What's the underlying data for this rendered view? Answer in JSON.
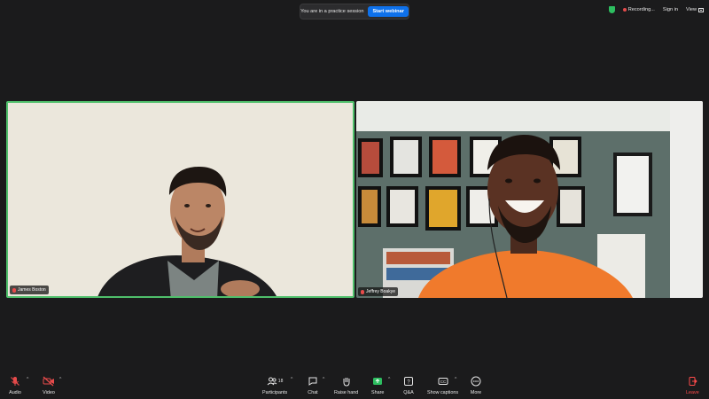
{
  "banner": {
    "text": "You are in a practice session",
    "button": "Start webinar"
  },
  "top_right": {
    "recording": "Recording...",
    "sign_in": "Sign in",
    "view": "View"
  },
  "participants": [
    {
      "name": "James Boston"
    },
    {
      "name": "Jeffrey Boakye"
    }
  ],
  "toolbar": {
    "audio": "Audio",
    "video": "Video",
    "participants": "Participants",
    "participants_count": "18",
    "chat": "Chat",
    "raise_hand": "Raise hand",
    "share": "Share",
    "qa": "Q&A",
    "show_captions": "Show captions",
    "more": "More",
    "leave": "Leave"
  },
  "colors": {
    "accent": "#0e71eb",
    "active_speaker_border": "#4fbf6b",
    "share_green": "#2dbe60",
    "leave_red": "#ff4b4b"
  }
}
